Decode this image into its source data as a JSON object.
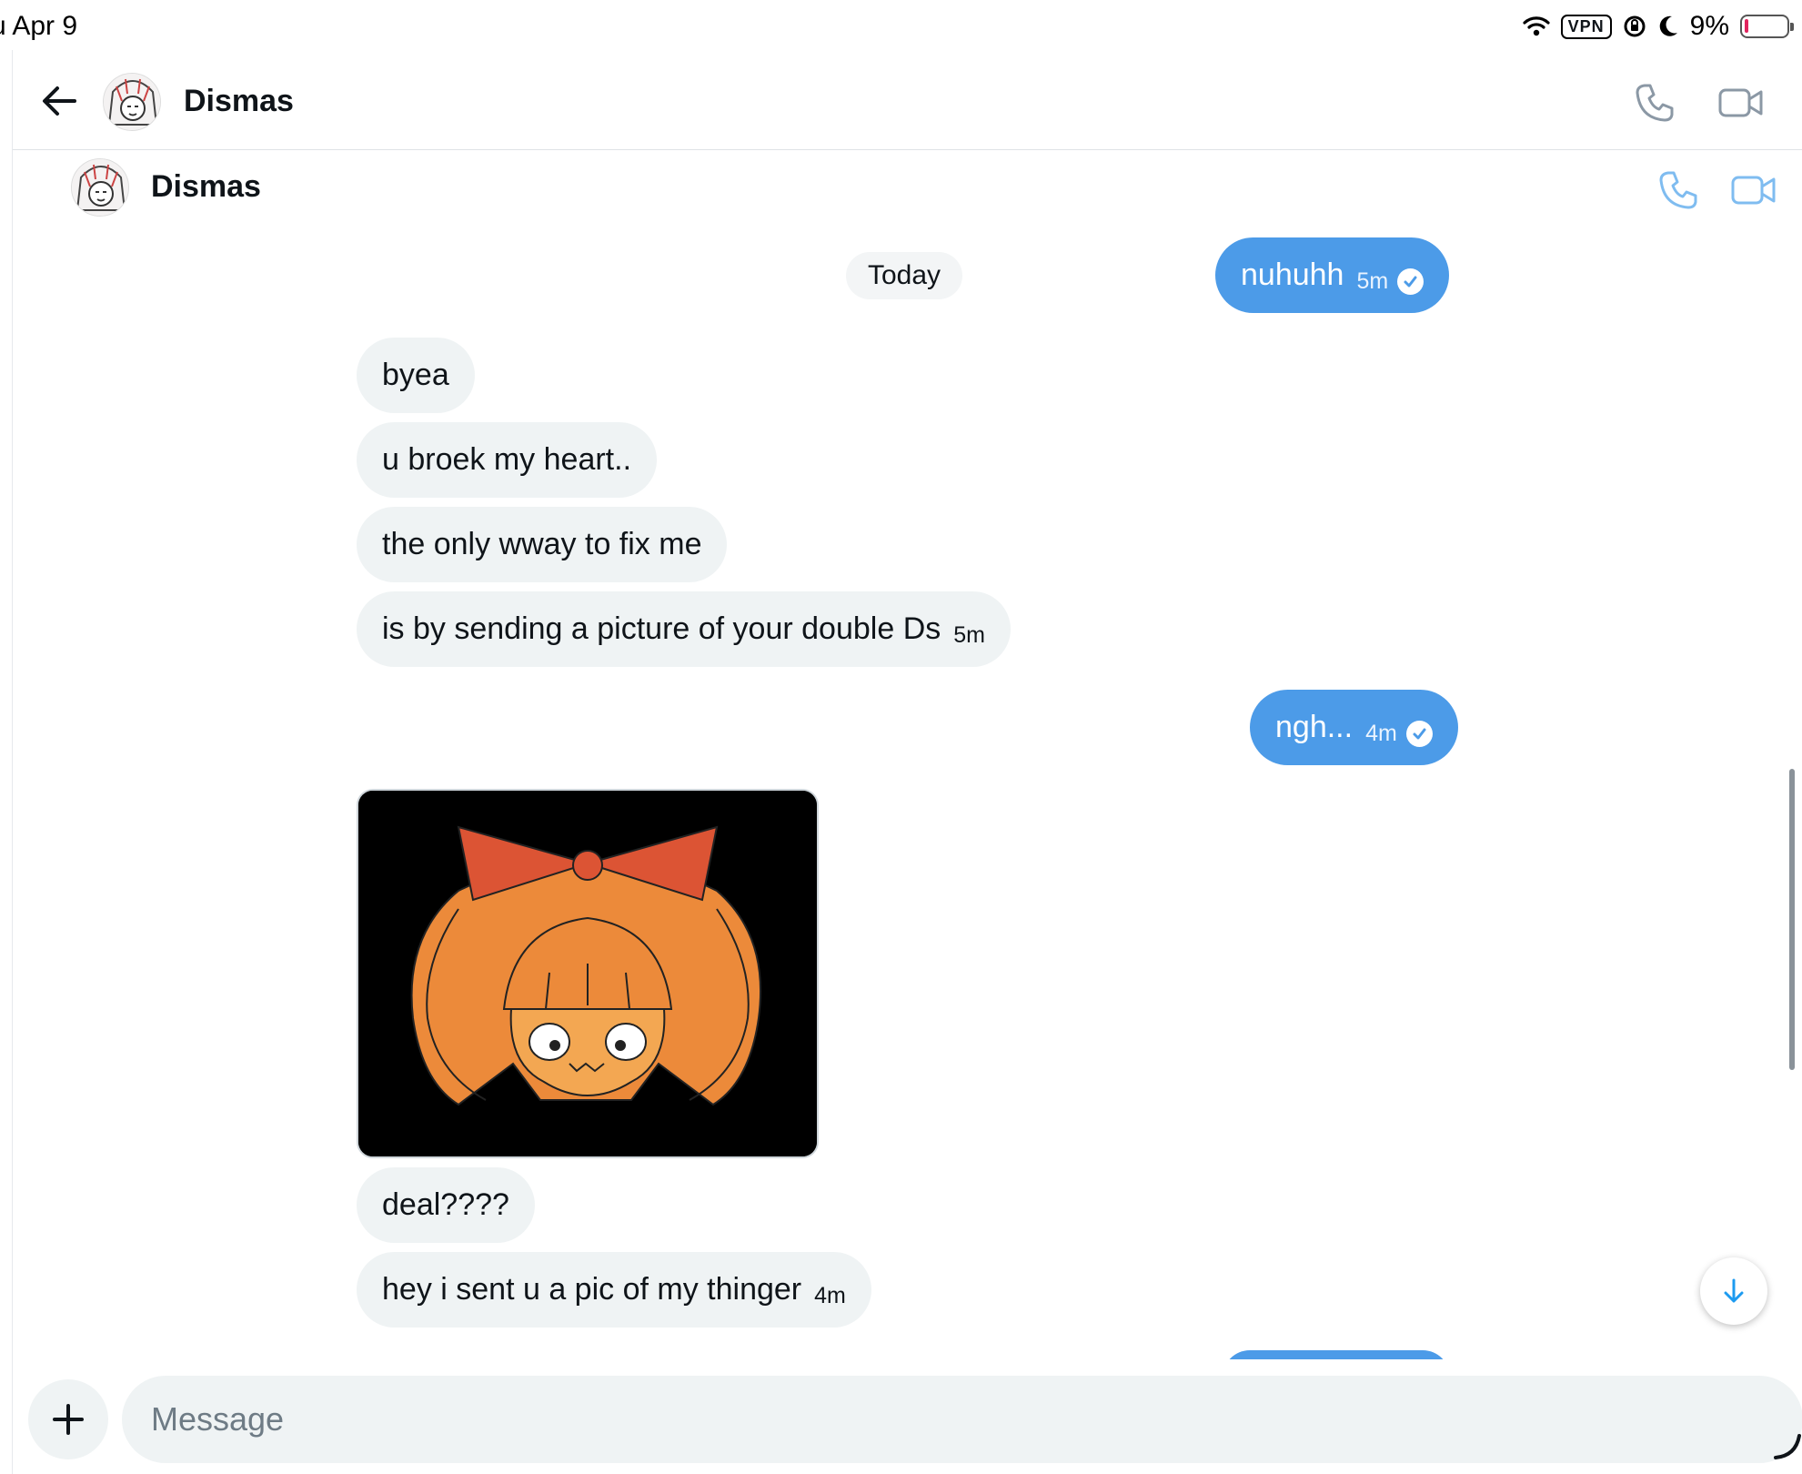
{
  "status_bar": {
    "date": "u Apr 9",
    "vpn": "VPN",
    "battery_percent": "9%",
    "battery_level": 0.09
  },
  "header": {
    "contact_name": "Dismas",
    "icons": [
      "back-arrow-icon",
      "phone-icon",
      "video-icon"
    ]
  },
  "conversation_header": {
    "contact_name": "Dismas"
  },
  "chat": {
    "date_separator": "Today",
    "messages": [
      {
        "dir": "out",
        "text": "nuhuhh",
        "time": "5m",
        "read": true
      },
      {
        "dir": "in",
        "text": "byea"
      },
      {
        "dir": "in",
        "text": "u broek my heart.."
      },
      {
        "dir": "in",
        "text": "the only wway to fix me"
      },
      {
        "dir": "in",
        "text": "is by sending a picture of your double Ds",
        "time": "5m"
      },
      {
        "dir": "out",
        "text": "ngh...",
        "time": "4m",
        "read": true
      },
      {
        "dir": "in",
        "type": "image"
      },
      {
        "dir": "in",
        "text": "deal????"
      },
      {
        "dir": "in",
        "text": "hey i sent u a pic of my thinger",
        "time": "4m"
      }
    ]
  },
  "composer": {
    "placeholder": "Message"
  },
  "colors": {
    "outgoing_bubble": "#4c9be8",
    "incoming_bubble": "#eff3f4",
    "accent": "#1d9bf0",
    "battery_low": "#e0245e"
  }
}
